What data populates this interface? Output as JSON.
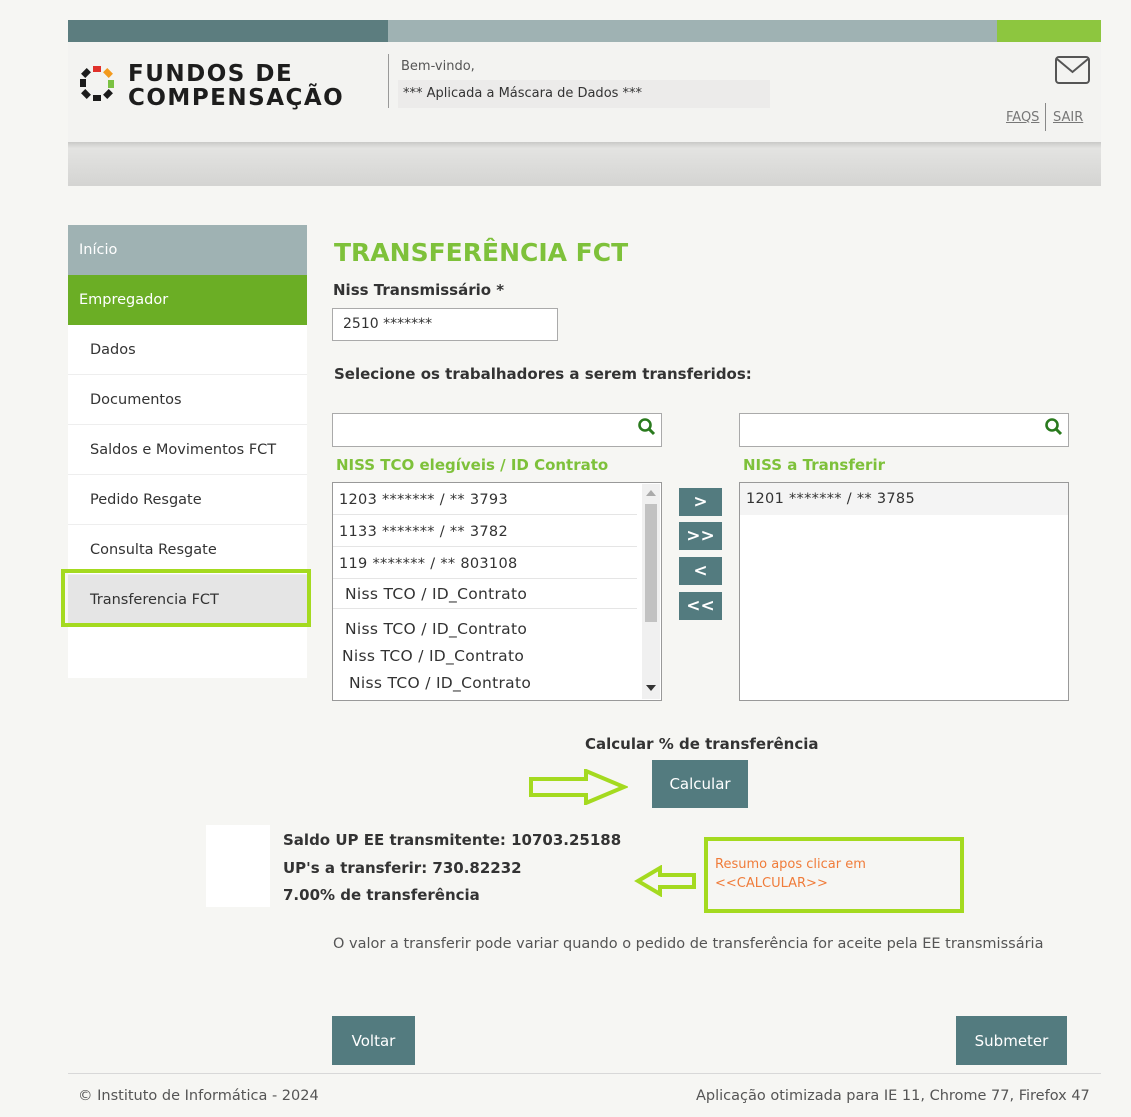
{
  "header": {
    "logo_line1": "FUNDOS DE",
    "logo_line2": "COMPENSAÇÃO",
    "welcome": "Bem-vindo,",
    "mask": "*** Aplicada a Máscara de Dados ***",
    "faqs": "FAQS",
    "sair": "SAIR",
    "colors": {
      "accent_green": "#8dc63f",
      "dark_teal": "#5c7d7f",
      "title_green": "#7ec13a",
      "highlight": "#a4da1f"
    }
  },
  "sidebar": {
    "items": [
      {
        "label": "Início"
      },
      {
        "label": "Empregador"
      },
      {
        "label": "Dados"
      },
      {
        "label": "Documentos"
      },
      {
        "label": "Saldos e Movimentos FCT"
      },
      {
        "label": "Pedido Resgate"
      },
      {
        "label": "Consulta Resgate"
      },
      {
        "label": "Transferencia FCT"
      }
    ]
  },
  "main": {
    "title": "TRANSFERÊNCIA FCT",
    "niss_label": "Niss Transmissário *",
    "niss_value": "2510 *******",
    "select_label": "Selecione os trabalhadores a serem transferidos:",
    "left_list": {
      "header": "NISS TCO elegíveis / ID Contrato",
      "rows": [
        "1203 ******* / **   3793",
        "1133 ******* / **  3782",
        "119 ******* / **  803108",
        "Niss TCO / ID_Contrato",
        "Niss TCO / ID_Contrato",
        "Niss TCO / ID_Contrato",
        "Niss TCO / ID_Contrato"
      ]
    },
    "right_list": {
      "header": "NISS a Transferir",
      "rows": [
        "1201 ******* / **  3785"
      ]
    },
    "move_buttons": [
      ">",
      ">>",
      "<",
      "<<"
    ],
    "calc_label": "Calcular % de transferência",
    "calc_button": "Calcular",
    "result": {
      "saldo": "Saldo UP EE transmitente: 10703.25188",
      "ups": "UP's a transferir: 730.82232",
      "pct": "7.00% de transferência"
    },
    "note_line1": "Resumo apos clicar em",
    "note_line2": "<<CALCULAR>>",
    "info": "O valor a transferir pode variar quando o pedido de transferência for aceite pela EE transmissária",
    "voltar": "Voltar",
    "submeter": "Submeter"
  },
  "footer": {
    "copyright": "© Instituto de Informática - 2024",
    "optimized": "Aplicação otimizada para IE 11, Chrome 77, Firefox 47"
  }
}
